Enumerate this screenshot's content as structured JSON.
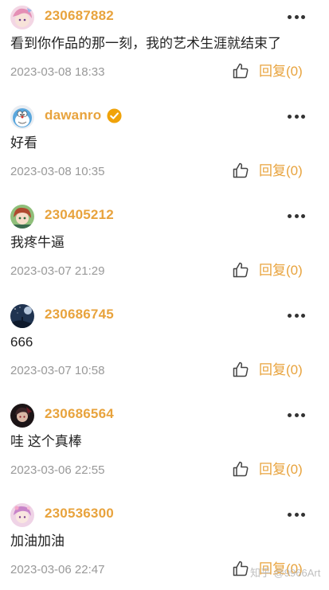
{
  "comments": [
    {
      "username": "230687882",
      "verified": false,
      "content": "看到你作品的那一刻，我的艺术生涯就结束了",
      "time": "2023-03-08 18:33",
      "reply_label": "回复(0)",
      "avatar": "pink-anime-avatar"
    },
    {
      "username": "dawanro",
      "verified": true,
      "content": "好看",
      "time": "2023-03-08 10:35",
      "reply_label": "回复(0)",
      "avatar": "doraemon-avatar"
    },
    {
      "username": "230405212",
      "verified": false,
      "content": "我疼牛逼",
      "time": "2023-03-07 21:29",
      "reply_label": "回复(0)",
      "avatar": "green-hair-avatar"
    },
    {
      "username": "230686745",
      "verified": false,
      "content": "666",
      "time": "2023-03-07 10:58",
      "reply_label": "回复(0)",
      "avatar": "night-sky-avatar"
    },
    {
      "username": "230686564",
      "verified": false,
      "content": "哇 这个真棒",
      "time": "2023-03-06 22:55",
      "reply_label": "回复(0)",
      "avatar": "dark-character-avatar"
    },
    {
      "username": "230536300",
      "verified": false,
      "content": "加油加油",
      "time": "2023-03-06 22:47",
      "reply_label": "回复(0)",
      "avatar": "pink-flower-avatar"
    }
  ],
  "watermark": "知乎 @9966Art",
  "colors": {
    "accent": "#e8a33d",
    "text": "#222222",
    "muted": "#999999",
    "verified": "#f0a30a"
  }
}
